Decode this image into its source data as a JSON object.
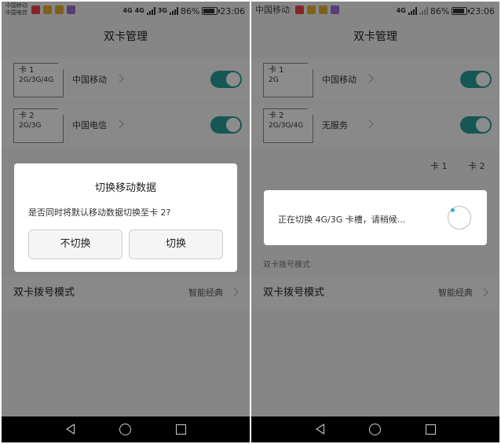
{
  "screens": [
    {
      "status": {
        "carrier_1": "中国移动",
        "carrier_2": "中国电信",
        "badge_1": "4G",
        "badge_2": "4G",
        "badge_3": "3G",
        "battery": "86%",
        "time": "23:06"
      },
      "title": "双卡管理",
      "sims": [
        {
          "slot": "卡 1",
          "type": "2G/3G/4G",
          "carrier": "中国移动",
          "enabled": true
        },
        {
          "slot": "卡 2",
          "type": "2G/3G",
          "carrier": "中国电信",
          "enabled": true
        }
      ],
      "partial_label": "卡",
      "dial_mode": {
        "label": "双卡拨号模式",
        "value": "智能经典"
      },
      "dialog": {
        "title": "切换移动数据",
        "message": "是否同时将默认移动数据切换至卡 2?",
        "cancel_label": "不切换",
        "confirm_label": "切换"
      }
    },
    {
      "status": {
        "carrier": "中国移动",
        "badge_1": "4G",
        "battery": "86%",
        "time": "23:06"
      },
      "title": "双卡管理",
      "sims": [
        {
          "slot": "卡 1",
          "type": "2G",
          "carrier": "中国移动",
          "enabled": true
        },
        {
          "slot": "卡 2",
          "type": "2G/3G/4G",
          "carrier": "无服务",
          "enabled": true
        }
      ],
      "pref_cols": [
        "卡 1",
        "卡 2"
      ],
      "section_label": "双卡拨号模式",
      "dial_mode": {
        "label": "双卡拨号模式",
        "value": "智能经典"
      },
      "progress_message": "正在切换 4G/3G 卡槽，请稍候..."
    }
  ],
  "accent_color": "#2b9e97",
  "spinner_color": "#2bb8c0"
}
